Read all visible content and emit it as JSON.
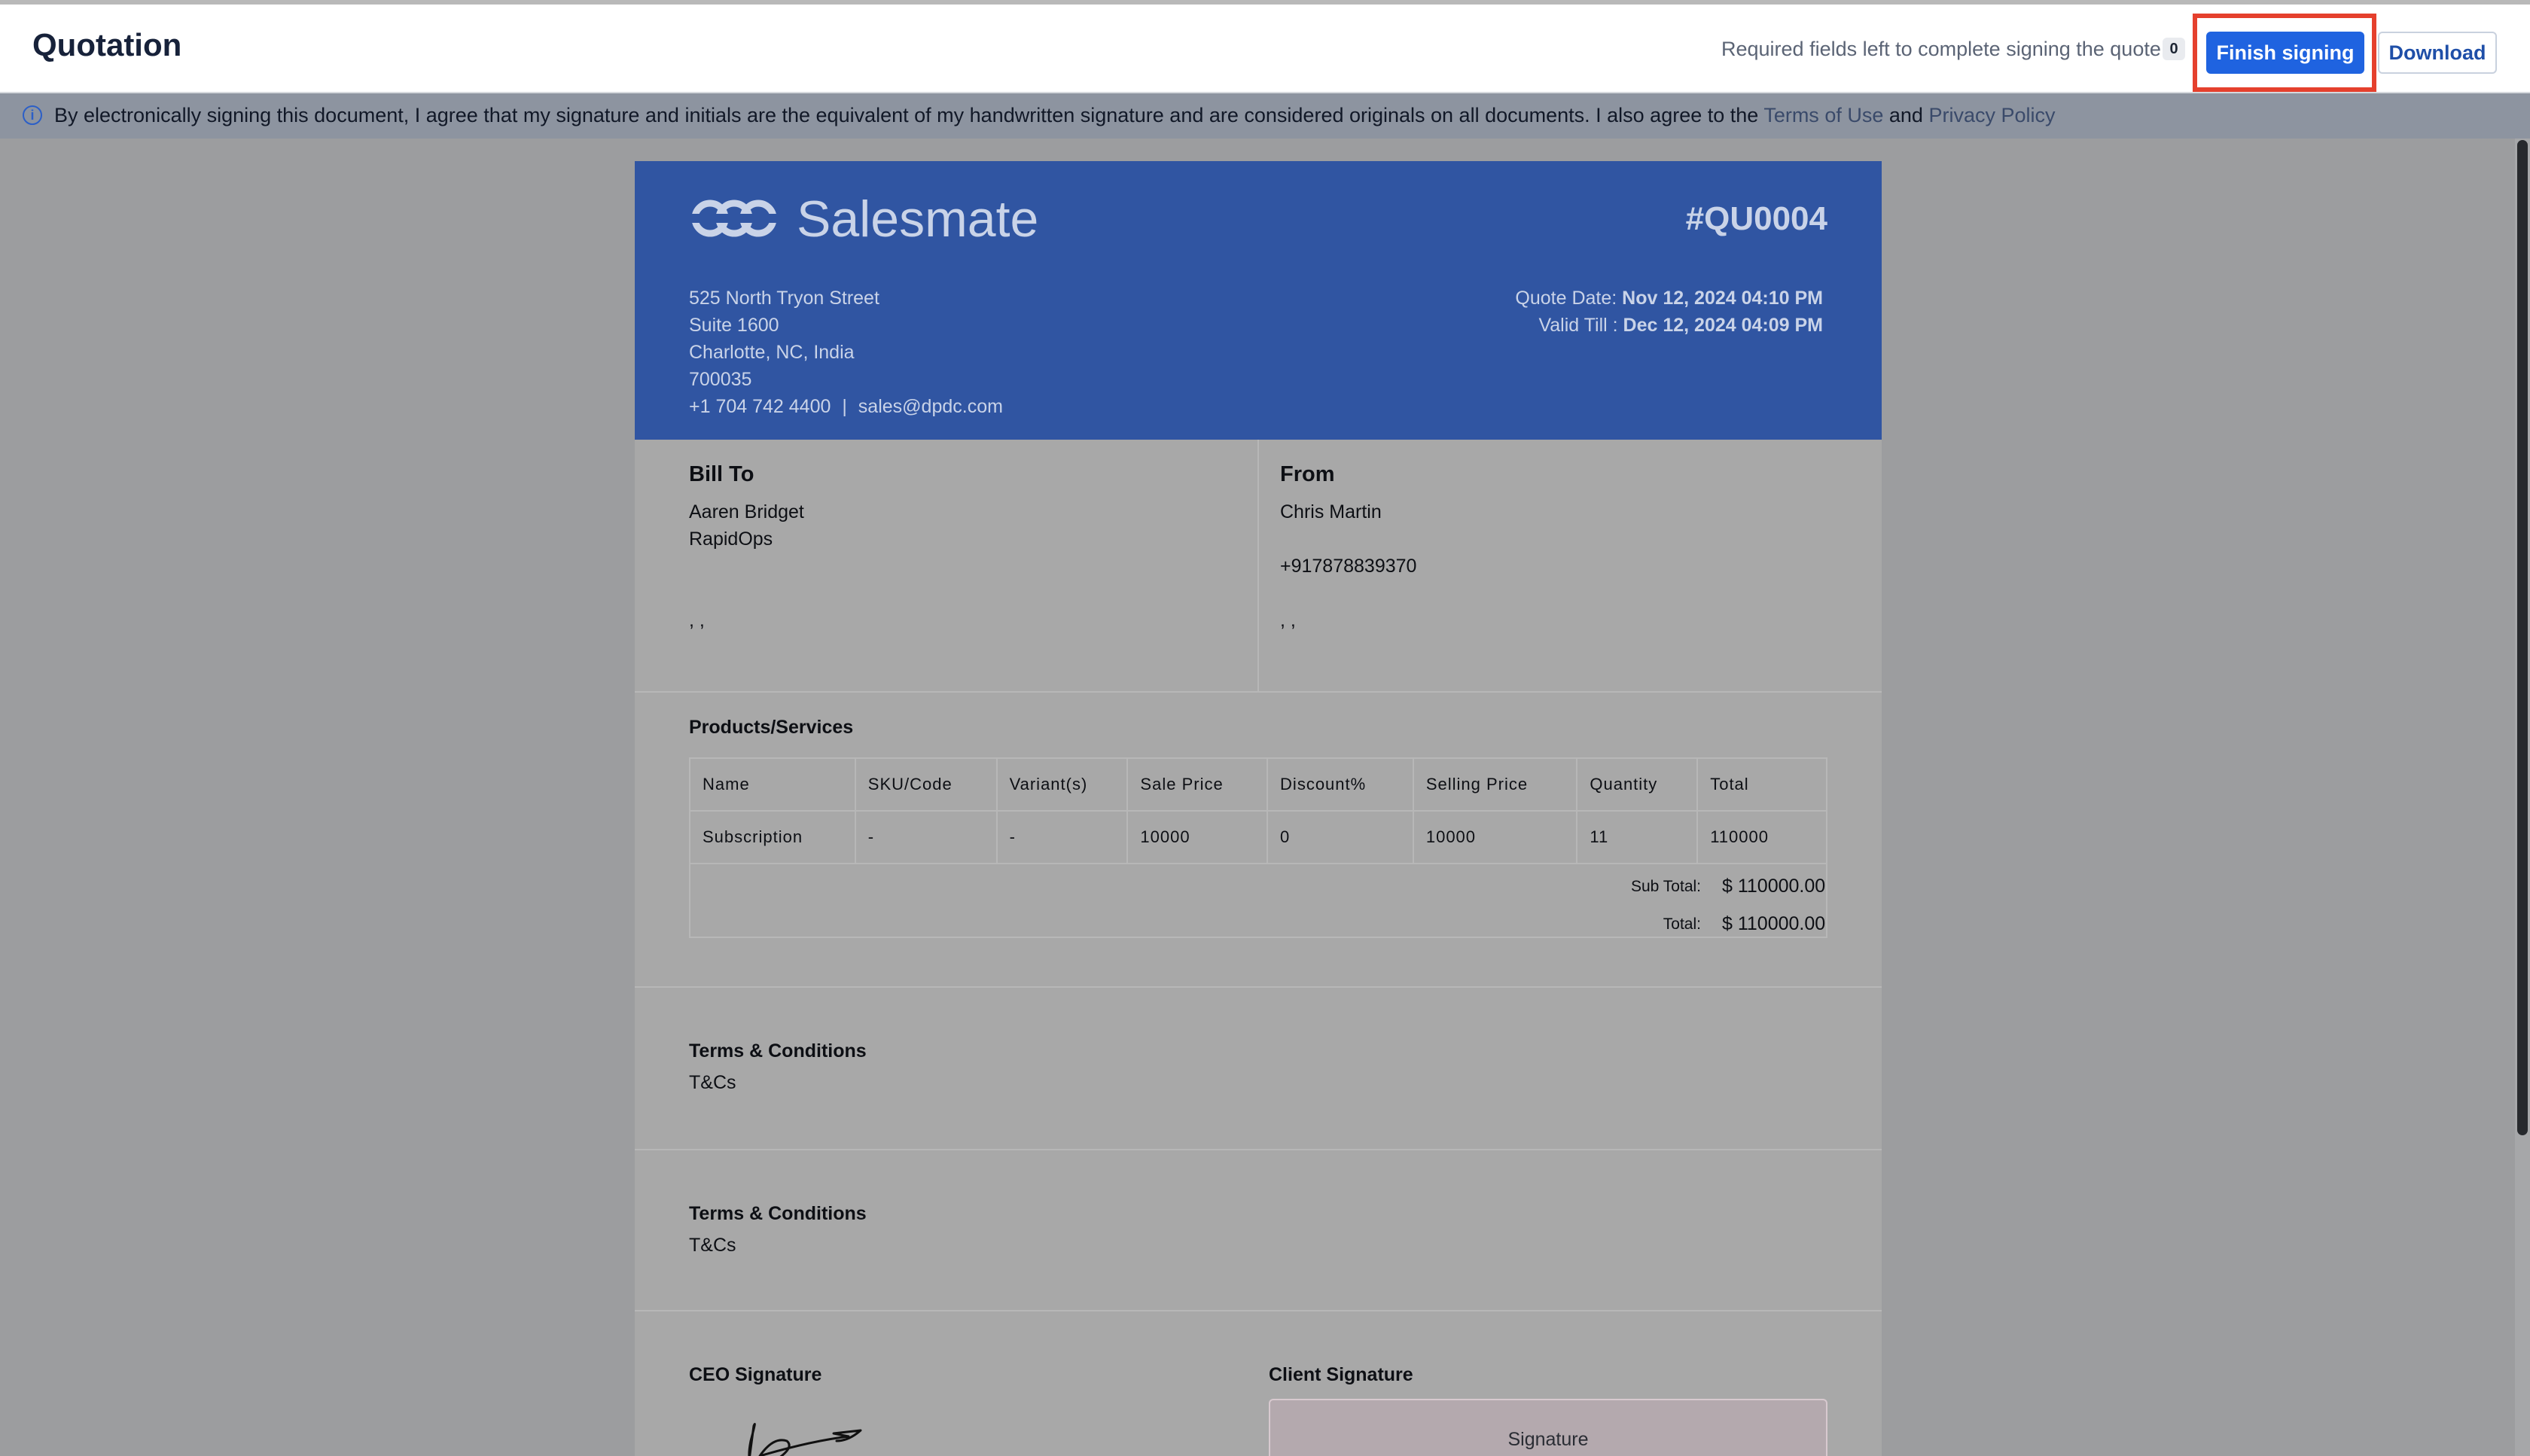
{
  "header": {
    "title": "Quotation",
    "required_text": "Required fields left to complete signing the quote:",
    "required_count": "0",
    "finish_label": "Finish signing",
    "download_label": "Download"
  },
  "banner": {
    "text": "By electronically signing this document, I agree that my signature and initials are the equivalent of my handwritten signature and are considered originals on all documents. I also agree to the",
    "terms_link": "Terms of Use",
    "and": "and",
    "privacy_link": "Privacy Policy"
  },
  "company": {
    "name": "Salesmate",
    "quote_number": "#QU0004",
    "address": [
      "525 North Tryon Street",
      "Suite 1600",
      "Charlotte, NC, India",
      "700035"
    ],
    "phone": "+1 704 742 4400",
    "sep": "|",
    "email": "sales@dpdc.com",
    "quote_date_label": "Quote Date:",
    "quote_date": "Nov 12, 2024 04:10 PM",
    "valid_till_label": "Valid Till :",
    "valid_till": "Dec 12, 2024 04:09 PM"
  },
  "bill_to": {
    "heading": "Bill To",
    "name": "Aaren Bridget",
    "company": "RapidOps",
    "extra": ", ,"
  },
  "from": {
    "heading": "From",
    "name": "Chris Martin",
    "phone": "+917878839370",
    "extra": ", ,"
  },
  "products": {
    "heading": "Products/Services",
    "columns": [
      "Name",
      "SKU/Code",
      "Variant(s)",
      "Sale Price",
      "Discount%",
      "Selling Price",
      "Quantity",
      "Total"
    ],
    "rows": [
      [
        "Subscription",
        "-",
        "-",
        "10000",
        "0",
        "10000",
        "11",
        "110000"
      ]
    ],
    "subtotal_label": "Sub Total:",
    "subtotal": "$ 110000.00",
    "total_label": "Total:",
    "total": "$ 110000.00"
  },
  "terms": [
    {
      "heading": "Terms & Conditions",
      "body": "T&Cs"
    },
    {
      "heading": "Terms & Conditions",
      "body": "T&Cs"
    }
  ],
  "signatures": {
    "ceo_label": "CEO Signature",
    "client_label": "Client Signature",
    "client_placeholder": "Signature"
  },
  "colors": {
    "accent": "#1f63e0",
    "highlight": "#e5402d",
    "doc_header": "#3055a2"
  }
}
